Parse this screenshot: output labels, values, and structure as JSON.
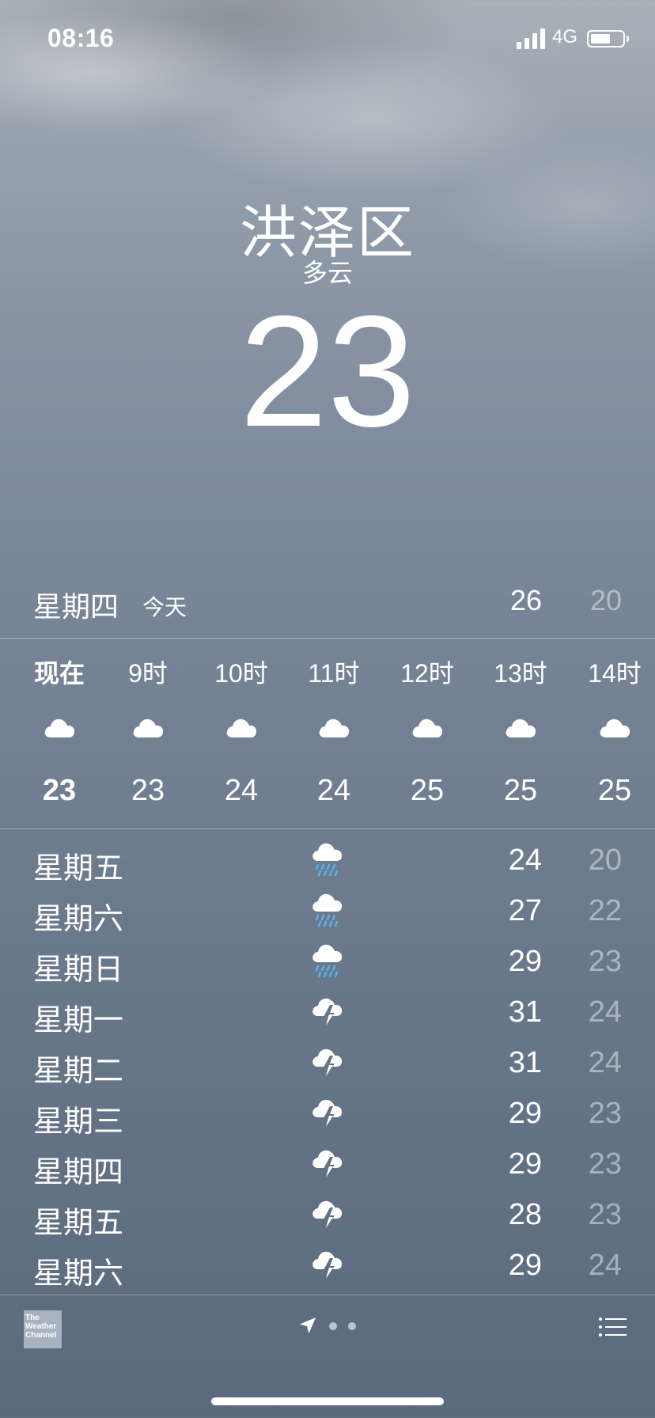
{
  "status_bar": {
    "time": "08:16",
    "network": "4G"
  },
  "location": {
    "city": "洪泽区",
    "condition": "多云",
    "temperature": "23"
  },
  "today": {
    "day": "星期四",
    "label": "今天",
    "high": "26",
    "low": "20"
  },
  "hourly": [
    {
      "label": "现在",
      "icon": "cloud-icon",
      "temp": "23"
    },
    {
      "label": "9时",
      "icon": "cloud-icon",
      "temp": "23"
    },
    {
      "label": "10时",
      "icon": "cloud-icon",
      "temp": "24"
    },
    {
      "label": "11时",
      "icon": "cloud-icon",
      "temp": "24"
    },
    {
      "label": "12时",
      "icon": "cloud-icon",
      "temp": "25"
    },
    {
      "label": "13时",
      "icon": "cloud-icon",
      "temp": "25"
    },
    {
      "label": "14时",
      "icon": "cloud-icon",
      "temp": "25"
    }
  ],
  "daily": [
    {
      "day": "星期五",
      "icon": "rain-icon",
      "high": "24",
      "low": "20"
    },
    {
      "day": "星期六",
      "icon": "rain-icon",
      "high": "27",
      "low": "22"
    },
    {
      "day": "星期日",
      "icon": "rain-icon",
      "high": "29",
      "low": "23"
    },
    {
      "day": "星期一",
      "icon": "thunderstorm-icon",
      "high": "31",
      "low": "24"
    },
    {
      "day": "星期二",
      "icon": "thunderstorm-icon",
      "high": "31",
      "low": "24"
    },
    {
      "day": "星期三",
      "icon": "thunderstorm-icon",
      "high": "29",
      "low": "23"
    },
    {
      "day": "星期四",
      "icon": "thunderstorm-icon",
      "high": "29",
      "low": "23"
    },
    {
      "day": "星期五",
      "icon": "thunderstorm-icon",
      "high": "28",
      "low": "23"
    },
    {
      "day": "星期六",
      "icon": "thunderstorm-icon",
      "high": "29",
      "low": "24"
    }
  ],
  "footer": {
    "logo_lines": [
      "The",
      "Weather",
      "Channel"
    ]
  },
  "colors": {
    "rain_drops": "#5ab3f0",
    "secondary_text": "rgba(255,255,255,0.45)"
  }
}
